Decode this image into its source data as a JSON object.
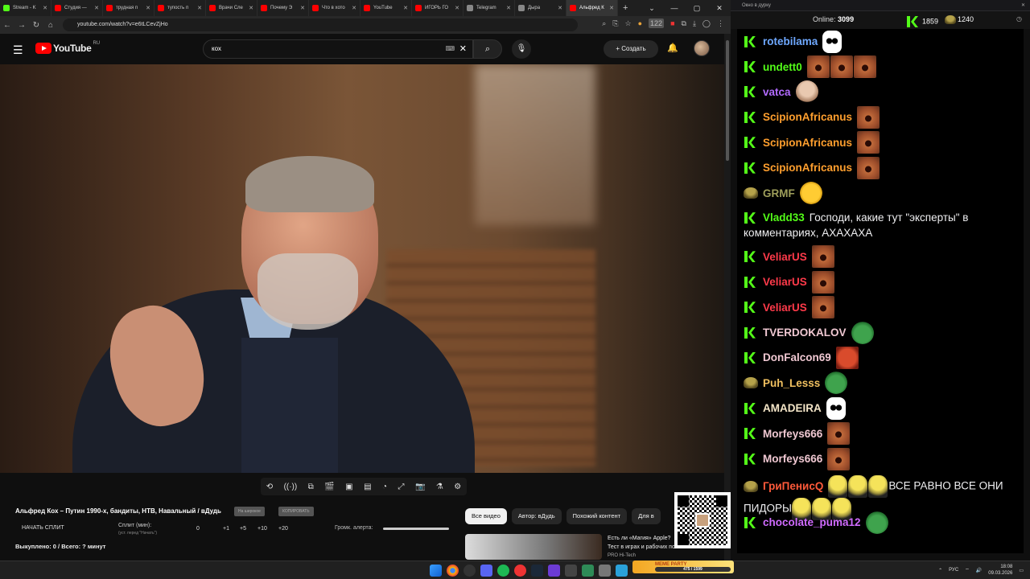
{
  "browser": {
    "tabs": [
      {
        "label": "Stream - K",
        "color": "#53fc18",
        "active": false
      },
      {
        "label": "Студия —",
        "color": "#ff0000",
        "active": false
      },
      {
        "label": "трудная п",
        "color": "#ff0000",
        "active": false
      },
      {
        "label": "тупость п",
        "color": "#ff0000",
        "active": false
      },
      {
        "label": "Врачи Сле",
        "color": "#ff0000",
        "active": false
      },
      {
        "label": "Почему Э",
        "color": "#ff0000",
        "active": false
      },
      {
        "label": "Что в хото",
        "color": "#ff0000",
        "active": false
      },
      {
        "label": "YouTube",
        "color": "#ff0000",
        "active": false
      },
      {
        "label": "ИГОРЬ ГО",
        "color": "#ff0000",
        "active": false
      },
      {
        "label": "Telegram",
        "color": "#888888",
        "active": false
      },
      {
        "label": "Дыра",
        "color": "#888888",
        "active": false
      },
      {
        "label": "Альфред К",
        "color": "#ff0000",
        "active": true
      }
    ],
    "url": "youtube.com/watch?v=e6tLCevZjHo",
    "ext_badge": "122",
    "new_tab": "+",
    "window_buttons": [
      "⌄",
      "—",
      "▢",
      "✕"
    ]
  },
  "youtube": {
    "logo_text": "YouTube",
    "region": "RU",
    "search_value": "кох",
    "create_label": "Создать",
    "video_title": "Альфред Кох – Путин 1990-х, бандиты, НТВ, Навальный / вДудь",
    "chips": [
      "На широкое",
      "КОПИРОВАТЬ"
    ],
    "split": {
      "start": "НАЧАТЬ СПЛИТ",
      "label": "Сплит (мин):",
      "hint": "(уст. перед \"Начать\")",
      "values": [
        "0",
        "+1",
        "+5",
        "+10",
        "+20"
      ],
      "alert_label": "Громк. алерта:"
    },
    "bought": "Выкуплено: 0 / Всего: ? минут",
    "filters": [
      "Все видео",
      "Автор: вДудь",
      "Похожий контент",
      "Для в"
    ],
    "rec_title": "Есть ли «Магия» Apple? Тест в играх и рабочих по...",
    "rec_channel": "PRO Hi-Tech"
  },
  "chat": {
    "title": "Окно в дурку",
    "online_label": "Online:",
    "online": "3099",
    "kick_count": "1859",
    "other_count": "1240",
    "messages": [
      {
        "badge": "k",
        "name": "rotebilama",
        "color": "#6ea8ff",
        "emotes": [
          "ghost"
        ]
      },
      {
        "badge": "k",
        "name": "undett0",
        "color": "#53fc18",
        "emotes": [
          "screech",
          "screech",
          "screech"
        ]
      },
      {
        "badge": "k",
        "name": "vatca",
        "color": "#b26bff",
        "emotes": [
          "bald"
        ]
      },
      {
        "badge": "k",
        "name": "ScipionAfricanus",
        "color": "#ff9f2e",
        "emotes": [
          "screech"
        ]
      },
      {
        "badge": "k",
        "name": "ScipionAfricanus",
        "color": "#ff9f2e",
        "emotes": [
          "screech"
        ]
      },
      {
        "badge": "k",
        "name": "ScipionAfricanus",
        "color": "#ff9f2e",
        "emotes": [
          "screech"
        ]
      },
      {
        "badge": "e",
        "name": "GRMF",
        "color": "#9e9e5a",
        "emotes": [
          "laugh"
        ]
      },
      {
        "badge": "k",
        "name": "Vladd33",
        "color": "#53fc18",
        "text": "Господи, какие тут \"эксперты\" в комментариях, АХАХАХА",
        "emotes": []
      },
      {
        "badge": "k",
        "name": "VeliarUS",
        "color": "#ff3a4a",
        "emotes": [
          "screech"
        ]
      },
      {
        "badge": "k",
        "name": "VeliarUS",
        "color": "#ff3a4a",
        "emotes": [
          "screech"
        ]
      },
      {
        "badge": "k",
        "name": "VeliarUS",
        "color": "#ff3a4a",
        "emotes": [
          "screech"
        ]
      },
      {
        "badge": "k",
        "name": "TVERDOKALOV",
        "color": "#f0c8d2",
        "emotes": [
          "pepe"
        ]
      },
      {
        "badge": "k",
        "name": "DonFalcon69",
        "color": "#f0c8d2",
        "emotes": [
          "red"
        ]
      },
      {
        "badge": "e",
        "name": "Puh_Lesss",
        "color": "#f0c060",
        "emotes": [
          "pepe"
        ]
      },
      {
        "badge": "k",
        "name": "AMADEIRA",
        "color": "#f5e6c8",
        "emotes": [
          "ghost"
        ]
      },
      {
        "badge": "k",
        "name": "Morfeys666",
        "color": "#f0c8d2",
        "emotes": [
          "screech"
        ]
      },
      {
        "badge": "k",
        "name": "Morfeys666",
        "color": "#f0c8d2",
        "emotes": [
          "screech"
        ]
      },
      {
        "badge": "e",
        "name": "ГриПенисQ",
        "color": "#ff5a3a",
        "text": "ВСЕ РАВНО ВСЕ ОНИ ПИДОРЫ",
        "emotes": [
          "troph",
          "troph",
          "troph"
        ],
        "emotes_after": [
          "troph",
          "troph",
          "troph"
        ]
      },
      {
        "badge": "k",
        "name": "chocolate_puma12",
        "color": "#d06bff",
        "emotes": [
          "pepe"
        ]
      }
    ]
  },
  "taskbar": {
    "meme_label": "MEME PARTY",
    "meme_progress": "475 / 1599",
    "lang": "РУС",
    "time": "18:08",
    "date": "09.03.2026"
  }
}
